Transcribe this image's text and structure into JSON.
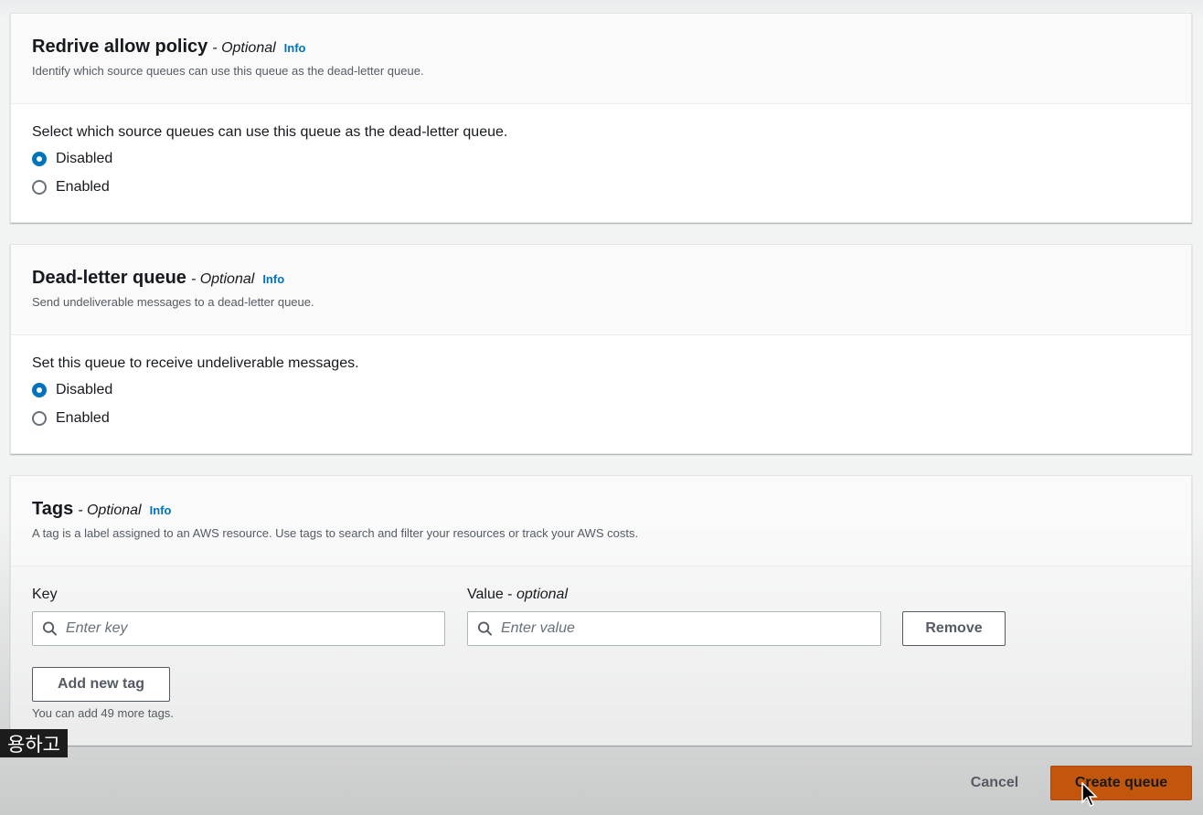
{
  "redrive": {
    "title": "Redrive allow policy",
    "optional": "- Optional",
    "info": "Info",
    "description": "Identify which source queues can use this queue as the dead-letter queue.",
    "prompt": "Select which source queues can use this queue as the dead-letter queue.",
    "options": [
      "Disabled",
      "Enabled"
    ],
    "selected": "Disabled"
  },
  "dlq": {
    "title": "Dead-letter queue",
    "optional": "- Optional",
    "info": "Info",
    "description": "Send undeliverable messages to a dead-letter queue.",
    "prompt": "Set this queue to receive undeliverable messages.",
    "options": [
      "Disabled",
      "Enabled"
    ],
    "selected": "Disabled"
  },
  "tags": {
    "title": "Tags",
    "optional": "- Optional",
    "info": "Info",
    "description": "A tag is a label assigned to an AWS resource. Use tags to search and filter your resources or track your AWS costs.",
    "key_label": "Key",
    "value_label_main": "Value - ",
    "value_label_optional": "optional",
    "key_placeholder": "Enter key",
    "value_placeholder": "Enter value",
    "remove_label": "Remove",
    "add_label": "Add new tag",
    "hint": "You can add 49 more tags."
  },
  "subtitle": "용하고",
  "footer": {
    "cancel_label": "Cancel",
    "create_label": "Create queue"
  },
  "colors": {
    "accent": "#0073bb",
    "primary_button": "#c2560d"
  }
}
